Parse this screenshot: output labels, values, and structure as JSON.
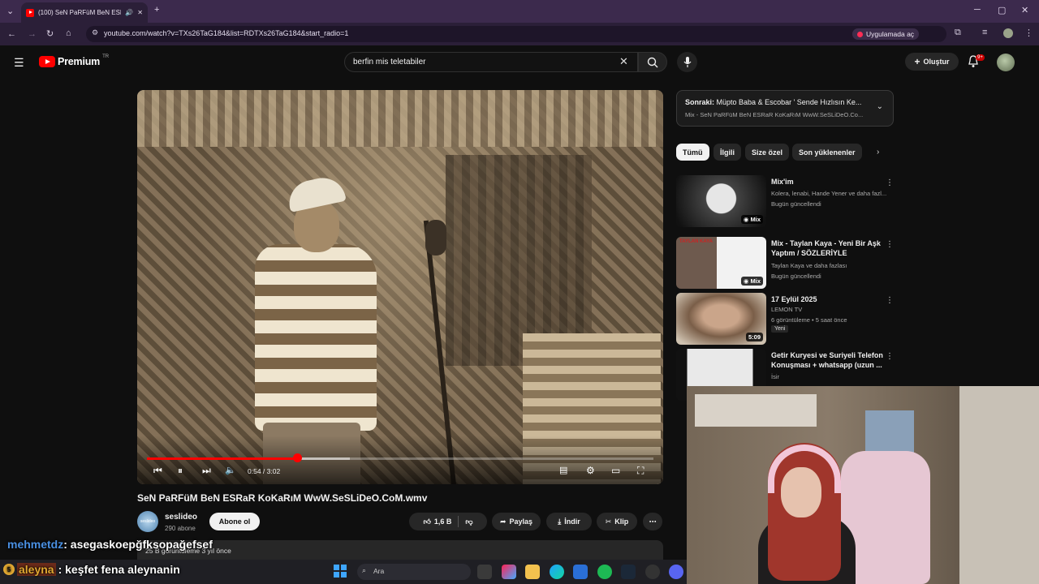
{
  "browser": {
    "tab_title": "(100) SeN PaRFüM BeN ESR...",
    "url": "youtube.com/watch?v=TXs26TaG184&list=RDTXs26TaG184&start_radio=1",
    "open_in_app": "Uygulamada aç"
  },
  "header": {
    "logo_word": "Premium",
    "logo_region": "TR",
    "search_query": "berfin mis teletabiler",
    "create_label": "Oluştur",
    "notif_count": "9+"
  },
  "player": {
    "time": "0:54 / 3:02",
    "progress_fraction": 0.297,
    "buffered_fraction": 0.4
  },
  "video": {
    "title": "SeN PaRFüM BeN ESRaR KoKaRıM WwW.SeSLiDeO.CoM.wmv",
    "channel": "seslideo",
    "channel_avatar_text": "seslideo",
    "subscribers": "290 abone",
    "subscribe_label": "Abone ol",
    "likes": "1,6 B",
    "share_label": "Paylaş",
    "download_label": "İndir",
    "clip_label": "Klip",
    "desc_meta": "25 B görüntüleme  3 yıl önce"
  },
  "upnext": {
    "prefix": "Sonraki:",
    "title": "Müpto Baba & Escobar ' Sende Hızlısın Ke...",
    "subtitle": "Mix - SeN PaRFüM BeN ESRaR KoKaRıM WwW.SeSLiDeO.Co..."
  },
  "chips": [
    "Tümü",
    "İlgili",
    "Size özel",
    "Son yüklenenler"
  ],
  "recommendations": [
    {
      "title": "Mix'im",
      "meta1": "Kolera, lenabi, Hande Yener ve daha fazl...",
      "meta2": "Bugün güncellendi",
      "badge": "Mix"
    },
    {
      "title": "Mix - Taylan Kaya - Yeni Bir Aşk Yaptım / SÖZLERİYLE",
      "meta1": "Taylan Kaya ve daha fazlası",
      "meta2": "Bugün güncellendi",
      "badge": "Mix",
      "thumb_text": "TAYLAN KAYA"
    },
    {
      "title": "17 Eylül 2025",
      "meta1": "LEMON TV",
      "meta2": "6 görüntüleme • 5 saat önce",
      "duration": "5:09",
      "new_label": "Yeni"
    },
    {
      "title": "Getir Kuryesi ve Suriyeli Telefon Konuşması + whatsapp (uzun ...",
      "meta1": "İsir",
      "meta2": ""
    }
  ],
  "overlay": {
    "chat1_user": "mehmetdz",
    "chat1_msg": ": asegaskoepğfksopağefsef",
    "chat2_badge": "5",
    "chat2_user": "aleyna",
    "chat2_msg": ": keşfet fena aleynanin"
  },
  "taskbar": {
    "search_label": "Ara"
  },
  "colors": {
    "youtube_red": "#ff0000",
    "background": "#0f0f0f",
    "chrome_purple": "#3c2a4d"
  }
}
